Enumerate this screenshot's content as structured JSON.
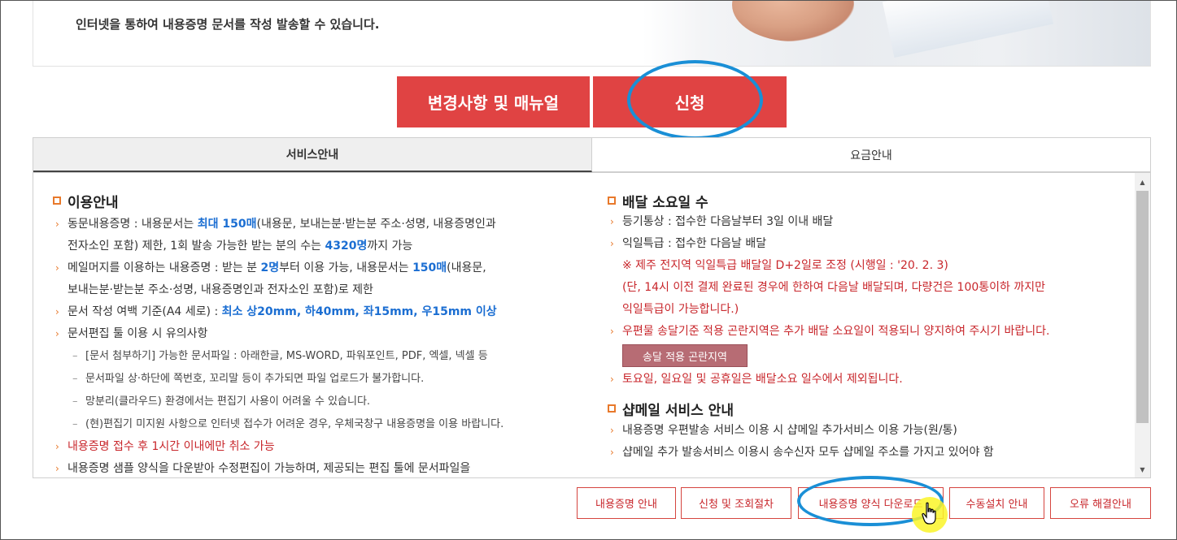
{
  "banner": {
    "text": "인터넷을 통하여 내용증명 문서를 작성 발송할 수 있습니다."
  },
  "main_buttons": {
    "manual": "변경사항 및 매뉴얼",
    "apply": "신청"
  },
  "tabs": [
    {
      "label": "서비스안내",
      "active": true
    },
    {
      "label": "요금안내",
      "active": false
    }
  ],
  "left": {
    "title": "이용안내",
    "b1": {
      "pre": "동문내용증명 : 내용문서는 ",
      "hl1": "최대 150매",
      "mid": "(내용문, 보내는분·받는분 주소·성명, 내용증명인과",
      "line2": "전자소인 포함) 제한, 1회 발송 가능한 받는 분의 수는 ",
      "hl2": "4320명",
      "post": "까지 가능"
    },
    "b2": {
      "pre": "메일머지를 이용하는 내용증명 : 받는 분 ",
      "hl1": "2명",
      "mid": "부터 이용 가능, 내용문서는 ",
      "hl2": "150매",
      "post": "(내용문,",
      "line2": "보내는분·받는분 주소·성명, 내용증명인과 전자소인 포함)로 제한"
    },
    "b3": {
      "pre": "문서 작성 여백 기준(A4 세로) : ",
      "hl": "최소 상20mm, 하40mm, 좌15mm, 우15mm 이상"
    },
    "b4": "문서편집 툴 이용 시 유의사항",
    "subs": [
      "[문서 첨부하기] 가능한 문서파일 : 아래한글, MS-WORD, 파워포인트, PDF, 엑셀, 넥셀 등",
      "문서파일 상·하단에 쪽번호, 꼬리말 등이 추가되면 파일 업로드가 불가합니다.",
      "망분리(클라우드) 환경에서는 편집기 사용이 어려울 수 있습니다.",
      "(현)편집기 미지원 사항으로 인터넷 접수가 어려운 경우, 우체국창구 내용증명을 이용 바랍니다."
    ],
    "b5": "내용증명 접수 후 1시간 이내에만 취소 가능",
    "b6": "내용증명 샘플 양식을 다운받아 수정편집이 가능하며, 제공되는 편집 툴에 문서파일을"
  },
  "right": {
    "title1": "배달 소요일 수",
    "r1": "등기통상 : 접수한 다음날부터 3일 이내 배달",
    "r2": "익일특급 : 접수한 다음날 배달",
    "notice1": "※ 제주 전지역 익일특급 배달일 D+2일로 조정 (시행일 : '20. 2. 3)",
    "notice2": "(단, 14시 이전 결제 완료된 경우에 한하여 다음날 배달되며, 다량건은 100통이하 까지만",
    "notice3": "익일특급이 가능합니다.)",
    "r3": "우편물 송달기준 적용 곤란지역은 추가 배달 소요일이 적용되니 양지하여 주시기 바랍니다.",
    "area_button": "송달 적용 곤란지역",
    "r4": "토요일, 일요일 및 공휴일은 배달소요 일수에서 제외됩니다.",
    "title2": "샵메일 서비스 안내",
    "r5": "내용증명 우편발송 서비스 이용 시 샵메일 추가서비스 이용 가능(원/통)",
    "r6": "샵메일 추가 발송서비스 이용시 송수신자 모두 샵메일 주소를 가지고 있어야 함"
  },
  "bottom_buttons": {
    "guide": "내용증명 안내",
    "procedure": "신청 및 조회절차",
    "download": "내용증명 양식 다운로드",
    "manual_install": "수동설치 안내",
    "troubleshoot": "오류 해결안내"
  },
  "colors": {
    "brand_red": "#e04343",
    "highlight_blue": "#1b6ed2",
    "notice_red": "#c8262b",
    "annotation_blue": "#1a8fd6"
  }
}
